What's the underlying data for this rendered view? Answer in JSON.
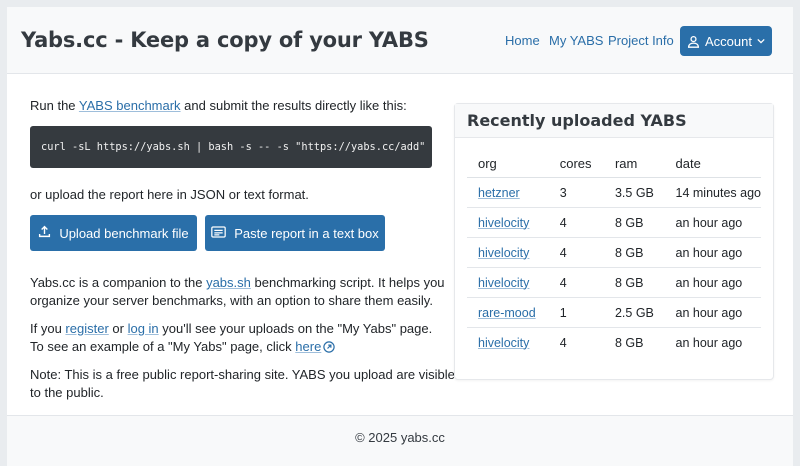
{
  "header": {
    "title": "Yabs.cc - Keep a copy of your YABS",
    "nav": {
      "home": "Home",
      "my_yabs": "My YABS",
      "project_info": "Project Info"
    },
    "account_label": "Account"
  },
  "intro": {
    "prefix": "Run the ",
    "link": "YABS benchmark",
    "suffix": " and submit the results directly like this:",
    "command": "curl -sL https://yabs.sh | bash -s -- -s \"https://yabs.cc/add\"",
    "or_upload": "or upload the report here in JSON or text format."
  },
  "buttons": {
    "upload": "Upload benchmark file",
    "paste": "Paste report in a text box"
  },
  "about": {
    "line1_prefix": "Yabs.cc is a companion to the ",
    "line1_link": "yabs.sh",
    "line1_suffix": " benchmarking script. It helps you",
    "line2": "organize your server benchmarks, with an option to share them easily."
  },
  "login": {
    "p1": "If you ",
    "register": "register",
    "p2": " or ",
    "login": "log in",
    "p3": " you'll see your uploads on the \"My Yabs\" page.",
    "line2_prefix": "To see an example of a \"My Yabs\" page, click ",
    "here": "here"
  },
  "note": {
    "line1": "Note: This is a free public report-sharing site. YABS you upload are visible",
    "line2": "to the public."
  },
  "recent": {
    "title": "Recently uploaded YABS",
    "columns": [
      "org",
      "cores",
      "ram",
      "date"
    ],
    "rows": [
      {
        "org": "hetzner",
        "cores": "3",
        "ram": "3.5 GB",
        "date": "14 minutes ago"
      },
      {
        "org": "hivelocity",
        "cores": "4",
        "ram": "8 GB",
        "date": "an hour ago"
      },
      {
        "org": "hivelocity",
        "cores": "4",
        "ram": "8 GB",
        "date": "an hour ago"
      },
      {
        "org": "hivelocity",
        "cores": "4",
        "ram": "8 GB",
        "date": "an hour ago"
      },
      {
        "org": "rare-mood",
        "cores": "1",
        "ram": "2.5 GB",
        "date": "an hour ago"
      },
      {
        "org": "hivelocity",
        "cores": "4",
        "ram": "8 GB",
        "date": "an hour ago"
      }
    ]
  },
  "footer": {
    "text": "© 2025 yabs.cc"
  },
  "colors": {
    "primary": "#2a6fa9",
    "link": "#2a6ea8",
    "code_bg": "#353a3f"
  },
  "icons": {
    "account": "user-icon",
    "dropdown": "chevron-down-icon",
    "upload": "upload-icon",
    "paste": "text-box-icon",
    "external": "external-link-icon"
  }
}
